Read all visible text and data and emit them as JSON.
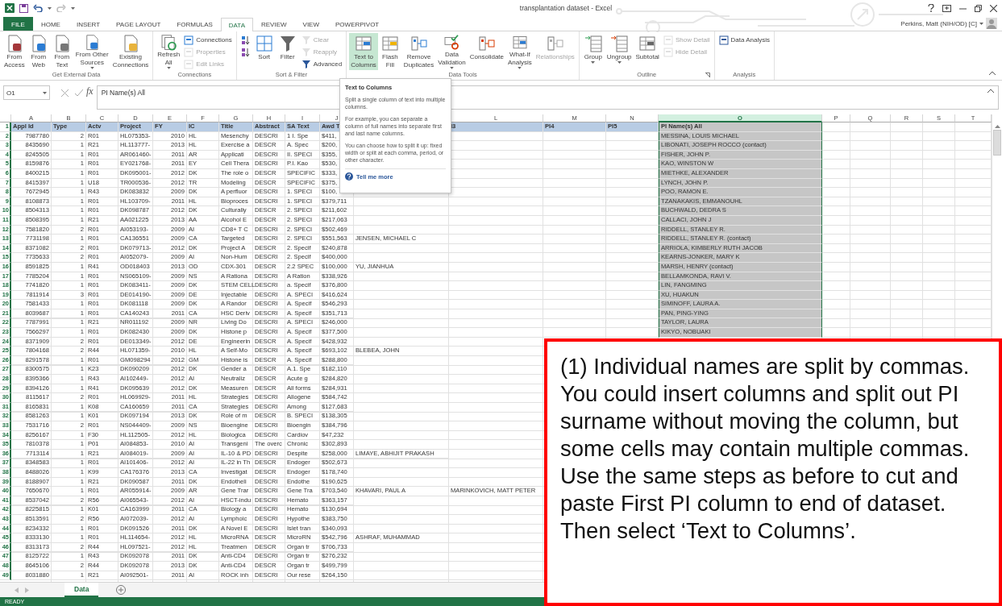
{
  "window": {
    "title": "transplantation dataset - Excel"
  },
  "tabs": [
    {
      "label": "FILE",
      "kind": "file",
      "selected": false
    },
    {
      "label": "HOME",
      "kind": "tab",
      "selected": false
    },
    {
      "label": "INSERT",
      "kind": "tab",
      "selected": false
    },
    {
      "label": "PAGE LAYOUT",
      "kind": "tab",
      "selected": false
    },
    {
      "label": "FORMULAS",
      "kind": "tab",
      "selected": false
    },
    {
      "label": "DATA",
      "kind": "tab",
      "selected": true
    },
    {
      "label": "REVIEW",
      "kind": "tab",
      "selected": false
    },
    {
      "label": "VIEW",
      "kind": "tab",
      "selected": false
    },
    {
      "label": "POWERPIVOT",
      "kind": "tab",
      "selected": false
    }
  ],
  "user": {
    "name": "Perkins, Matt (NIH/OD) [C]"
  },
  "ribbon": {
    "groups": [
      {
        "label": "Get External Data",
        "launcher": false,
        "items": [
          {
            "kind": "large",
            "lines": [
              "From",
              "Access"
            ],
            "dropdown": false,
            "disabled": false,
            "selected": false
          },
          {
            "kind": "large",
            "lines": [
              "From",
              "Web"
            ],
            "dropdown": false,
            "disabled": false,
            "selected": false
          },
          {
            "kind": "large",
            "lines": [
              "From",
              "Text"
            ],
            "dropdown": false,
            "disabled": false,
            "selected": false
          },
          {
            "kind": "large",
            "lines": [
              "From Other",
              "Sources"
            ],
            "dropdown": true,
            "disabled": false,
            "selected": false
          },
          {
            "kind": "large",
            "lines": [
              "Existing",
              "Connections"
            ],
            "dropdown": false,
            "disabled": false,
            "selected": false
          }
        ]
      },
      {
        "label": "Connections",
        "launcher": false,
        "items": [
          {
            "kind": "large",
            "lines": [
              "Refresh",
              "All"
            ],
            "dropdown": true,
            "disabled": false,
            "selected": false
          },
          {
            "kind": "stack",
            "items": [
              {
                "label": "Connections",
                "disabled": false
              },
              {
                "label": "Properties",
                "disabled": true
              },
              {
                "label": "Edit Links",
                "disabled": true
              }
            ]
          }
        ]
      },
      {
        "label": "Sort & Filter",
        "launcher": false,
        "items": [
          {
            "kind": "stack",
            "items": [
              {
                "disabled": false
              },
              {
                "disabled": false
              }
            ]
          },
          {
            "kind": "large",
            "lines": [
              "Sort"
            ],
            "dropdown": false,
            "disabled": false,
            "selected": false
          },
          {
            "kind": "large",
            "lines": [
              "Filter"
            ],
            "dropdown": false,
            "disabled": false,
            "selected": false
          },
          {
            "kind": "stack",
            "items": [
              {
                "label": "Clear",
                "disabled": true
              },
              {
                "label": "Reapply",
                "disabled": true
              },
              {
                "label": "Advanced",
                "disabled": false
              }
            ]
          }
        ]
      },
      {
        "label": "Data Tools",
        "launcher": false,
        "items": [
          {
            "kind": "large",
            "lines": [
              "Text to",
              "Columns"
            ],
            "dropdown": false,
            "disabled": false,
            "selected": true
          },
          {
            "kind": "large",
            "lines": [
              "Flash",
              "Fill"
            ],
            "dropdown": false,
            "disabled": false,
            "selected": false
          },
          {
            "kind": "large",
            "lines": [
              "Remove",
              "Duplicates"
            ],
            "dropdown": false,
            "disabled": false,
            "selected": false
          },
          {
            "kind": "large",
            "lines": [
              "Data",
              "Validation"
            ],
            "dropdown": true,
            "disabled": false,
            "selected": false
          },
          {
            "kind": "large",
            "lines": [
              "Consolidate"
            ],
            "dropdown": false,
            "disabled": false,
            "selected": false
          },
          {
            "kind": "large",
            "lines": [
              "What-If",
              "Analysis"
            ],
            "dropdown": true,
            "disabled": false,
            "selected": false
          },
          {
            "kind": "large",
            "lines": [
              "Relationships"
            ],
            "dropdown": false,
            "disabled": true,
            "selected": false
          }
        ]
      },
      {
        "label": "Outline",
        "launcher": true,
        "items": [
          {
            "kind": "large",
            "lines": [
              "Group"
            ],
            "dropdown": true,
            "disabled": false,
            "selected": false
          },
          {
            "kind": "large",
            "lines": [
              "Ungroup"
            ],
            "dropdown": true,
            "disabled": false,
            "selected": false
          },
          {
            "kind": "large",
            "lines": [
              "Subtotal"
            ],
            "dropdown": false,
            "disabled": false,
            "selected": false
          },
          {
            "kind": "stack",
            "items": [
              {
                "label": "Show Detail",
                "disabled": true
              },
              {
                "label": "Hide Detail",
                "disabled": true
              }
            ]
          }
        ]
      },
      {
        "label": "Analysis",
        "launcher": false,
        "items": [
          {
            "kind": "stack",
            "items": [
              {
                "label": "Data Analysis",
                "disabled": false
              }
            ]
          }
        ]
      }
    ]
  },
  "formula_bar": {
    "name_box": "O1",
    "fx": "fx",
    "value": "PI Name(s) All"
  },
  "tooltip": {
    "title": "Text to Columns",
    "paragraphs": [
      "Split a single column of text into multiple columns.",
      "For example, you can separate a column of full names into separate first and last name columns.",
      "You can choose how to split it up: fixed width or split at each comma, period, or other character."
    ],
    "link": "Tell me more"
  },
  "sheet": {
    "columns": [
      {
        "letter": "A",
        "selected": false
      },
      {
        "letter": "B",
        "selected": false
      },
      {
        "letter": "C",
        "selected": false
      },
      {
        "letter": "D",
        "selected": false
      },
      {
        "letter": "E",
        "selected": false
      },
      {
        "letter": "F",
        "selected": false
      },
      {
        "letter": "G",
        "selected": false
      },
      {
        "letter": "H",
        "selected": false
      },
      {
        "letter": "I",
        "selected": false
      },
      {
        "letter": "J",
        "selected": false
      },
      {
        "letter": "L",
        "selected": false
      },
      {
        "letter": "M",
        "selected": false
      },
      {
        "letter": "N",
        "selected": false
      },
      {
        "letter": "O",
        "selected": true
      },
      {
        "letter": "P",
        "selected": false
      },
      {
        "letter": "Q",
        "selected": false
      },
      {
        "letter": "R",
        "selected": false
      },
      {
        "letter": "S",
        "selected": false
      },
      {
        "letter": "T",
        "selected": false
      }
    ],
    "header_row": {
      "number": "1",
      "cells": {
        "A": "Appl Id",
        "B": "Type",
        "C": "Actv",
        "D": "Project",
        "E": "FY",
        "F": "IC",
        "G": "Title",
        "H": "Abstract",
        "I": "SA Text",
        "J": "Awd T",
        "L": "I3",
        "M": "PI4",
        "N": "PI5",
        "O": "PI Name(s) All"
      }
    },
    "rows": [
      {
        "number": "2",
        "cells": {
          "A": "7987780",
          "B": "2",
          "C": "R01",
          "D": "HL075353-",
          "E": "2010",
          "F": "HL",
          "G": "Mesenchy",
          "H": "DESCRI",
          "I": "1 I. Spe",
          "J": "$411,",
          "O": "MESSINA, LOUIS MICHAEL"
        }
      },
      {
        "number": "3",
        "cells": {
          "A": "8435690",
          "B": "1",
          "C": "R21",
          "D": "HL113777-",
          "E": "2013",
          "F": "HL",
          "G": "Exercise a",
          "H": "DESCR",
          "I": "A. Spec",
          "J": "$200,",
          "O": "LIBONATI, JOSEPH ROCCO (contact)"
        }
      },
      {
        "number": "4",
        "cells": {
          "A": "8245505",
          "B": "1",
          "C": "R01",
          "D": "AR061460-",
          "E": "2011",
          "F": "AR",
          "G": "Applicati",
          "H": "DESCRI",
          "I": "II. SPECI",
          "J": "$355,",
          "O": "FISHER, JOHN P."
        }
      },
      {
        "number": "5",
        "cells": {
          "A": "8159876",
          "B": "1",
          "C": "R01",
          "D": "EY021768-",
          "E": "2011",
          "F": "EY",
          "G": "Cell Thera",
          "H": "DESCRI",
          "I": "P.I. Kao",
          "J": "$530,",
          "O": "KAO, WINSTON W"
        }
      },
      {
        "number": "6",
        "cells": {
          "A": "8400215",
          "B": "1",
          "C": "R01",
          "D": "DK095001-",
          "E": "2012",
          "F": "DK",
          "G": "The role o",
          "H": "DESCR",
          "I": "SPECIFIC",
          "J": "$333,",
          "O": "MIETHKE, ALEXANDER"
        }
      },
      {
        "number": "7",
        "cells": {
          "A": "8415397",
          "B": "1",
          "C": "U18",
          "D": "TR000536-",
          "E": "2012",
          "F": "TR",
          "G": "Modeling",
          "H": "DESCR",
          "I": "SPECIFIC",
          "J": "$375,",
          "O": "LYNCH, JOHN P."
        }
      },
      {
        "number": "8",
        "cells": {
          "A": "7672945",
          "B": "1",
          "C": "R43",
          "D": "DK083832",
          "E": "2009",
          "F": "DK",
          "G": "A perfluor",
          "H": "DESCRI",
          "I": "1. SPECI",
          "J": "$100,",
          "O": "POO, RAMON E."
        }
      },
      {
        "number": "9",
        "cells": {
          "A": "8108873",
          "B": "1",
          "C": "R01",
          "D": "HL103709-",
          "E": "2011",
          "F": "HL",
          "G": "Bioproces",
          "H": "DESCRI",
          "I": "1. SPECI",
          "J": "$379,711",
          "O": "TZANAKAKIS, EMMANOUHL"
        }
      },
      {
        "number": "10",
        "cells": {
          "A": "8504313",
          "B": "1",
          "C": "R01",
          "D": "DK098787",
          "E": "2012",
          "F": "DK",
          "G": "Culturally",
          "H": "DESCR",
          "I": "2. SPECI",
          "J": "$211,602",
          "O": "BUCHWALD, DEDRA S"
        }
      },
      {
        "number": "11",
        "cells": {
          "A": "8508395",
          "B": "1",
          "C": "R21",
          "D": "AA021225",
          "E": "2013",
          "F": "AA",
          "G": "Alcohol E",
          "H": "DESCR",
          "I": "2. SPECI",
          "J": "$217,063",
          "O": "CALLACI, JOHN J"
        }
      },
      {
        "number": "12",
        "cells": {
          "A": "7581820",
          "B": "2",
          "C": "R01",
          "D": "AI053193-",
          "E": "2009",
          "F": "AI",
          "G": "CD8+ T C",
          "H": "DESCRI",
          "I": "2. SPECI",
          "J": "$502,469",
          "O": "RIDDELL, STANLEY R."
        }
      },
      {
        "number": "13",
        "cells": {
          "A": "7731198",
          "B": "1",
          "C": "R01",
          "D": "CA136551",
          "E": "2009",
          "F": "CA",
          "G": "Targeted",
          "H": "DESCRI",
          "I": "2. SPECI",
          "J": "$551,563",
          "K": "JENSEN, MICHAEL C",
          "O": "RIDDELL, STANLEY R. (contact)"
        }
      },
      {
        "number": "14",
        "cells": {
          "A": "8371082",
          "B": "2",
          "C": "R01",
          "D": "DK079713-",
          "E": "2012",
          "F": "DK",
          "G": "Project A",
          "H": "DESCR",
          "I": "2. Specif",
          "J": "$240,878",
          "O": "ARRIOLA, KIMBERLY RUTH JACOB"
        }
      },
      {
        "number": "15",
        "cells": {
          "A": "7735633",
          "B": "2",
          "C": "R01",
          "D": "AI052079-",
          "E": "2009",
          "F": "AI",
          "G": "Non-Hum",
          "H": "DESCRI",
          "I": "2. Specif",
          "J": "$400,000",
          "O": "KEARNS-JONKER, MARY K"
        }
      },
      {
        "number": "16",
        "cells": {
          "A": "8591825",
          "B": "1",
          "C": "R41",
          "D": "OD018403",
          "E": "2013",
          "F": "OD",
          "G": "CDX-301",
          "H": "DESCR",
          "I": "2.2 SPEC",
          "J": "$100,000",
          "K": "YU, JIANHUA",
          "O": "MARSH, HENRY  (contact)"
        }
      },
      {
        "number": "17",
        "cells": {
          "A": "7785204",
          "B": "1",
          "C": "R01",
          "D": "NS065109-",
          "E": "2009",
          "F": "NS",
          "G": "A Rationa",
          "H": "DESCRI",
          "I": "A Ration",
          "J": "$338,926",
          "O": "BELLAMKONDA, RAVI V."
        }
      },
      {
        "number": "18",
        "cells": {
          "A": "7741820",
          "B": "1",
          "C": "R01",
          "D": "DK083411-",
          "E": "2009",
          "F": "DK",
          "G": "STEM CELL",
          "H": "DESCRI",
          "I": "a. Specif",
          "J": "$376,800",
          "O": "LIN, FANGMING"
        }
      },
      {
        "number": "19",
        "cells": {
          "A": "7811914",
          "B": "3",
          "C": "R01",
          "D": "DE014190-",
          "E": "2009",
          "F": "DE",
          "G": "Injectable",
          "H": "DESCRI",
          "I": "A. SPECI",
          "J": "$416,624",
          "O": "XU, HUAKUN"
        }
      },
      {
        "number": "20",
        "cells": {
          "A": "7581433",
          "B": "1",
          "C": "R01",
          "D": "DK081118",
          "E": "2009",
          "F": "DK",
          "G": "A Randor",
          "H": "DESCRI",
          "I": "A. Specif",
          "J": "$546,293",
          "O": "SIMINOFF, LAURA A."
        }
      },
      {
        "number": "21",
        "cells": {
          "A": "8039687",
          "B": "1",
          "C": "R01",
          "D": "CA140243",
          "E": "2011",
          "F": "CA",
          "G": "HSC Deriv",
          "H": "DESCRI",
          "I": "A. Specif",
          "J": "$351,713",
          "O": "PAN, PING-YING"
        }
      },
      {
        "number": "22",
        "cells": {
          "A": "7787991",
          "B": "1",
          "C": "R21",
          "D": "NR011192",
          "E": "2009",
          "F": "NR",
          "G": "Living Do",
          "H": "DESCRI",
          "I": "A. SPECI",
          "J": "$246,000",
          "O": "TAYLOR, LAURA"
        }
      },
      {
        "number": "23",
        "cells": {
          "A": "7566297",
          "B": "1",
          "C": "R01",
          "D": "DK082430",
          "E": "2009",
          "F": "DK",
          "G": "Histone p",
          "H": "DESCRI",
          "I": "A. Specif",
          "J": "$377,500",
          "O": "KIKYO, NOBUAKI"
        }
      },
      {
        "number": "24",
        "cells": {
          "A": "8371909",
          "B": "2",
          "C": "R01",
          "D": "DE013349-",
          "E": "2012",
          "F": "DE",
          "G": "Engineerin",
          "H": "DESCR",
          "I": "A. Specif",
          "J": "$428,932"
        }
      },
      {
        "number": "25",
        "cells": {
          "A": "7804168",
          "B": "2",
          "C": "R44",
          "D": "HL071359-",
          "E": "2010",
          "F": "HL",
          "G": "A Self-Mo",
          "H": "DESCRI",
          "I": "A. Specif",
          "J": "$693,102",
          "K": "BLEBEA, JOHN"
        }
      },
      {
        "number": "26",
        "cells": {
          "A": "8291578",
          "B": "1",
          "C": "R01",
          "D": "GM098294",
          "E": "2012",
          "F": "GM",
          "G": "Histone is",
          "H": "DESCR",
          "I": "A. Specif",
          "J": "$288,800"
        }
      },
      {
        "number": "27",
        "cells": {
          "A": "8300575",
          "B": "1",
          "C": "K23",
          "D": "DK090209",
          "E": "2012",
          "F": "DK",
          "G": "Gender a",
          "H": "DESCR",
          "I": "A.1. Spe",
          "J": "$182,110"
        }
      },
      {
        "number": "28",
        "cells": {
          "A": "8395366",
          "B": "1",
          "C": "R43",
          "D": "AI102449-",
          "E": "2012",
          "F": "AI",
          "G": "Neutraliz",
          "H": "DESCR",
          "I": "Acute g",
          "J": "$284,820"
        }
      },
      {
        "number": "29",
        "cells": {
          "A": "8394126",
          "B": "1",
          "C": "R41",
          "D": "DK095639",
          "E": "2012",
          "F": "DK",
          "G": "Measuren",
          "H": "DESCR",
          "I": "All forms",
          "J": "$284,931"
        }
      },
      {
        "number": "30",
        "cells": {
          "A": "8115617",
          "B": "2",
          "C": "R01",
          "D": "HL069929-",
          "E": "2011",
          "F": "HL",
          "G": "Strategies",
          "H": "DESCRI",
          "I": "Allogene",
          "J": "$584,742"
        }
      },
      {
        "number": "31",
        "cells": {
          "A": "8165831",
          "B": "1",
          "C": "K08",
          "D": "CA160659",
          "E": "2011",
          "F": "CA",
          "G": "Strategies",
          "H": "DESCRI",
          "I": "Among",
          "J": "$127,683"
        }
      },
      {
        "number": "32",
        "cells": {
          "A": "8581263",
          "B": "1",
          "C": "K01",
          "D": "DK097194",
          "E": "2013",
          "F": "DK",
          "G": "Role of m",
          "H": "DESCR",
          "I": "B. SPECI",
          "J": "$138,305"
        }
      },
      {
        "number": "33",
        "cells": {
          "A": "7531716",
          "B": "2",
          "C": "R01",
          "D": "NS044409-",
          "E": "2009",
          "F": "NS",
          "G": "Bioengine",
          "H": "DESCRI",
          "I": "Bioengin",
          "J": "$384,796"
        }
      },
      {
        "number": "34",
        "cells": {
          "A": "8256167",
          "B": "1",
          "C": "F30",
          "D": "HL112505-",
          "E": "2012",
          "F": "HL",
          "G": "Biologica",
          "H": "DESCRI",
          "I": "Cardiov",
          "J": "$47,232"
        }
      },
      {
        "number": "35",
        "cells": {
          "A": "7810378",
          "B": "1",
          "C": "P01",
          "D": "AI084853-",
          "E": "2010",
          "F": "AI",
          "G": "Transgeni",
          "H": "The overc",
          "I": "Chronic",
          "J": "$302,893"
        }
      },
      {
        "number": "36",
        "cells": {
          "A": "7713114",
          "B": "1",
          "C": "R21",
          "D": "AI084019-",
          "E": "2009",
          "F": "AI",
          "G": "IL-10 & PD",
          "H": "DESCRI",
          "I": "Despite",
          "J": "$258,000",
          "K": "LIMAYE, ABHIJIT PRAKASH"
        }
      },
      {
        "number": "37",
        "cells": {
          "A": "8348583",
          "B": "1",
          "C": "R01",
          "D": "AI101406-",
          "E": "2012",
          "F": "AI",
          "G": "IL-22 in Th",
          "H": "DESCR",
          "I": "Endoger",
          "J": "$502,673"
        }
      },
      {
        "number": "38",
        "cells": {
          "A": "8488026",
          "B": "1",
          "C": "K99",
          "D": "CA176376",
          "E": "2013",
          "F": "CA",
          "G": "Investigat",
          "H": "DESCR",
          "I": "Endoger",
          "J": "$178,740"
        }
      },
      {
        "number": "39",
        "cells": {
          "A": "8188907",
          "B": "1",
          "C": "R21",
          "D": "DK090587",
          "E": "2011",
          "F": "DK",
          "G": "Endotheli",
          "H": "DESCRI",
          "I": "Endothe",
          "J": "$190,625"
        }
      },
      {
        "number": "40",
        "cells": {
          "A": "7650670",
          "B": "1",
          "C": "R01",
          "D": "AR055914-",
          "E": "2009",
          "F": "AR",
          "G": "Gene Trar",
          "H": "DESCRI",
          "I": "Gene Tra",
          "J": "$703,540",
          "K": "KHAVARI, PAUL A",
          "L": "MARINKOVICH, MATT PETER"
        }
      },
      {
        "number": "41",
        "cells": {
          "A": "8537042",
          "B": "2",
          "C": "R56",
          "D": "AI065543-",
          "E": "2012",
          "F": "AI",
          "G": "HSCT-indu",
          "H": "DESCRI",
          "I": "Hemato",
          "J": "$363,157"
        }
      },
      {
        "number": "42",
        "cells": {
          "A": "8225815",
          "B": "1",
          "C": "K01",
          "D": "CA163999",
          "E": "2011",
          "F": "CA",
          "G": "Biology a",
          "H": "DESCRI",
          "I": "Hemato",
          "J": "$130,694"
        }
      },
      {
        "number": "43",
        "cells": {
          "A": "8513591",
          "B": "2",
          "C": "R56",
          "D": "AI072039-",
          "E": "2012",
          "F": "AI",
          "G": "Lymphoic",
          "H": "DESCRI",
          "I": "Hypothe",
          "J": "$383,750"
        }
      },
      {
        "number": "44",
        "cells": {
          "A": "8234332",
          "B": "1",
          "C": "R01",
          "D": "DK091526",
          "E": "2011",
          "F": "DK",
          "G": "A Novel E",
          "H": "DESCRI",
          "I": "Islet tran",
          "J": "$340,093"
        }
      },
      {
        "number": "45",
        "cells": {
          "A": "8333130",
          "B": "1",
          "C": "R01",
          "D": "HL114654-",
          "E": "2012",
          "F": "HL",
          "G": "MicroRNA",
          "H": "DESCR",
          "I": "MicroRN",
          "J": "$542,796",
          "K": "ASHRAF, MUHAMMAD"
        }
      },
      {
        "number": "46",
        "cells": {
          "A": "8313173",
          "B": "2",
          "C": "R44",
          "D": "HL097521-",
          "E": "2012",
          "F": "HL",
          "G": "Treatmen",
          "H": "DESCR",
          "I": "Organ tr",
          "J": "$706,733"
        }
      },
      {
        "number": "47",
        "cells": {
          "A": "8125722",
          "B": "1",
          "C": "R43",
          "D": "DK092078",
          "E": "2011",
          "F": "DK",
          "G": "Anti-CD4",
          "H": "DESCRI",
          "I": "Organ tr",
          "J": "$276,232"
        }
      },
      {
        "number": "48",
        "cells": {
          "A": "8645106",
          "B": "2",
          "C": "R44",
          "D": "DK092078",
          "E": "2013",
          "F": "DK",
          "G": "Anti-CD4",
          "H": "DESCR",
          "I": "Organ tr",
          "J": "$499,799"
        }
      },
      {
        "number": "49",
        "cells": {
          "A": "8031880",
          "B": "1",
          "C": "R21",
          "D": "AI092501-",
          "E": "2011",
          "F": "AI",
          "G": "ROCK inh",
          "H": "DESCRI",
          "I": "Our rese",
          "J": "$264,150"
        }
      }
    ]
  },
  "sheet_tabs": [
    {
      "label": "Data",
      "selected": true
    }
  ],
  "status_bar": {
    "text": "READY"
  },
  "callout": {
    "text": "(1) Individual names are split by commas. You could insert columns and split out PI surname without moving the column, but some cells may contain multiple commas. Use the same steps as before to cut and paste First PI column to end of dataset.  Then select ‘Text to Columns’."
  }
}
